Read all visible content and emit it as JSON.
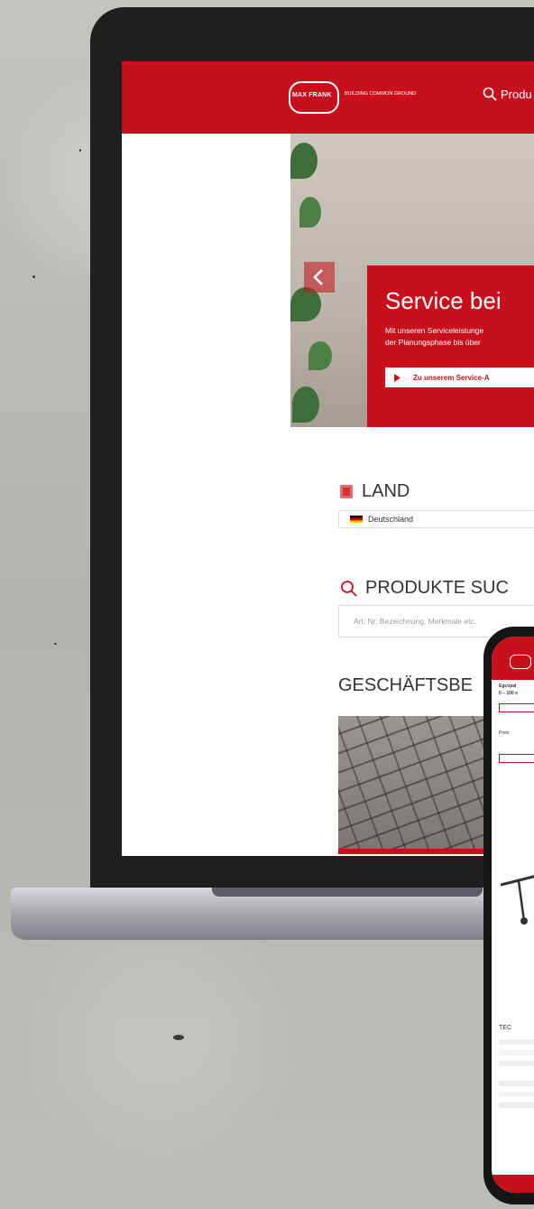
{
  "header": {
    "logo_name": "MAX FRANK",
    "logo_tagline": "BUILDING COMMON GROUND",
    "search_label": "Produ"
  },
  "hero": {
    "title": "Service bei",
    "text_line1": "Mit unseren Serviceleistunge",
    "text_line2": "der Planungsphase bis über",
    "button_label": "Zu unserem Service-A"
  },
  "country": {
    "label": "LAND",
    "selected": "Deutschland"
  },
  "product_search": {
    "label": "PRODUKTE SUC",
    "placeholder": "Art. Nr, Bezeichnung, Merkmale etc."
  },
  "business": {
    "label": "GESCHÄFTSBE"
  },
  "phone": {
    "title_line1": "Egcopal",
    "title_line2": "0 – 100 e",
    "price_label": "Preis",
    "section_label": "TEC"
  },
  "colors": {
    "brand_red": "#c7101b",
    "laptop_bezel": "#1f1f1f"
  }
}
